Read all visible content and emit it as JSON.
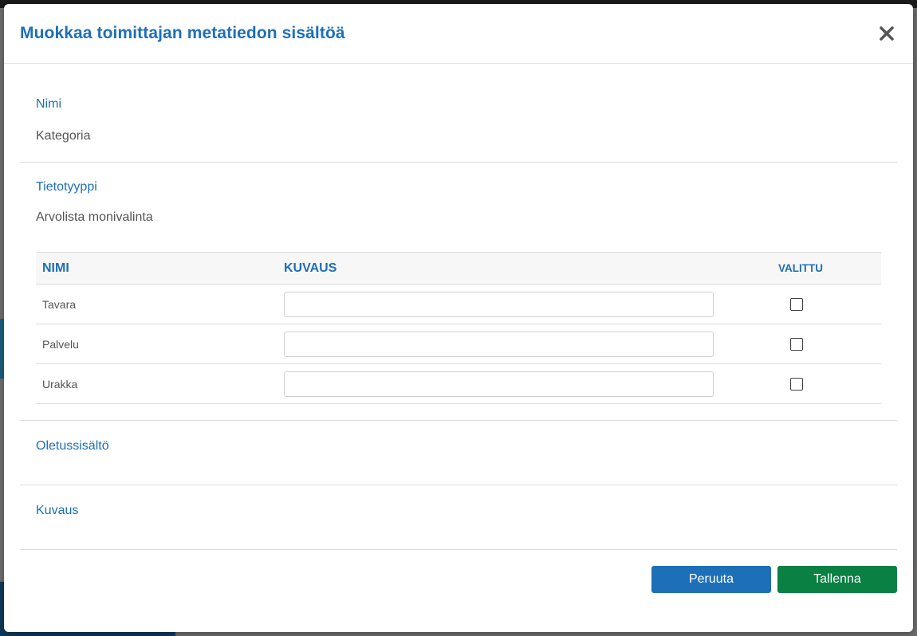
{
  "modal": {
    "title": "Muokkaa toimittajan metatiedon sisältöä"
  },
  "fields": {
    "name_label": "Nimi",
    "name_value": "Kategoria",
    "type_label": "Tietotyyppi",
    "type_value": "Arvolista monivalinta",
    "default_label": "Oletussisältö",
    "description_label": "Kuvaus"
  },
  "table": {
    "headers": {
      "name": "NIMI",
      "description": "KUVAUS",
      "selected": "VALITTU"
    },
    "rows": [
      {
        "name": "Tavara",
        "description": "",
        "selected": false
      },
      {
        "name": "Palvelu",
        "description": "",
        "selected": false
      },
      {
        "name": "Urakka",
        "description": "",
        "selected": false
      }
    ]
  },
  "buttons": {
    "cancel": "Peruuta",
    "save": "Tallenna"
  },
  "colors": {
    "accent": "#1d6fb8",
    "save": "#0a8043"
  },
  "icons": {
    "close": "close-icon"
  }
}
